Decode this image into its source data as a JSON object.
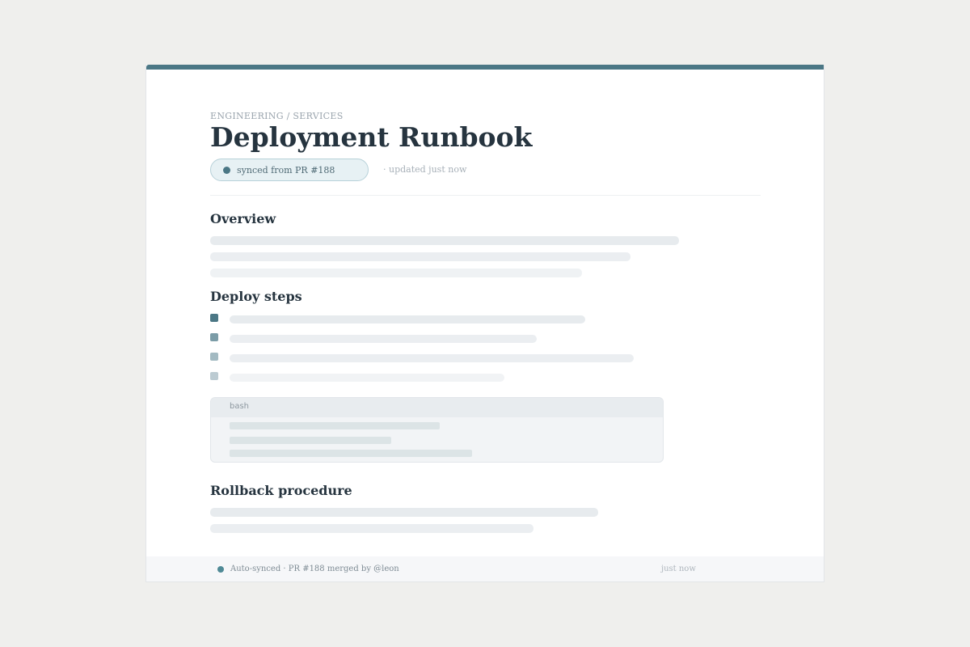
{
  "document": {
    "breadcrumb": "ENGINEERING / SERVICES",
    "title": "Deployment Runbook",
    "sync_badge": "synced from PR #188",
    "updated": "· updated just now"
  },
  "sections": {
    "overview": {
      "heading": "Overview"
    },
    "deploy_steps": {
      "heading": "Deploy steps",
      "checkbox_colors": [
        "#4b7785",
        "#7b9ca7",
        "#a3bac2",
        "#bccbd2"
      ]
    },
    "code_block": {
      "language": "bash"
    },
    "rollback": {
      "heading": "Rollback procedure"
    }
  },
  "footer": {
    "status": "Auto-synced · PR #188 merged by @leon",
    "time": "just now"
  },
  "colors": {
    "accent": "#4b7785",
    "background": "#efefed",
    "badge_background": "#e7f1f4"
  }
}
